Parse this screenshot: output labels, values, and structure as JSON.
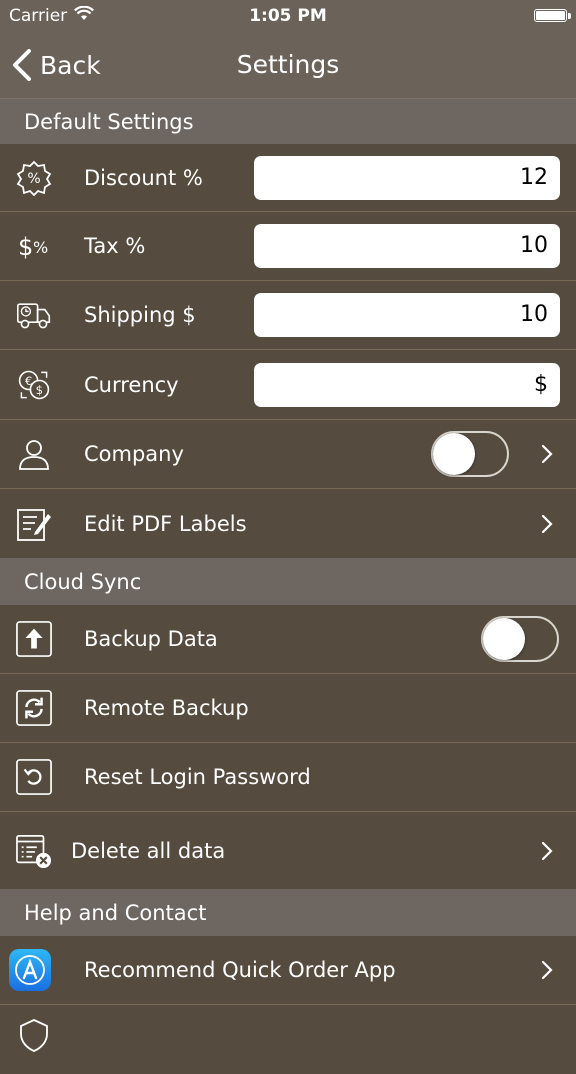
{
  "status_bar": {
    "carrier": "Carrier",
    "time": "1:05 PM"
  },
  "nav": {
    "back_label": "Back",
    "title": "Settings"
  },
  "sections": {
    "default_settings": {
      "header": "Default Settings",
      "discount": {
        "label": "Discount %",
        "value": "12",
        "icon": "discount-badge-icon"
      },
      "tax": {
        "label": "Tax %",
        "value": "10",
        "icon": "tax-percent-icon"
      },
      "shipping": {
        "label": "Shipping $",
        "value": "10",
        "icon": "delivery-truck-icon"
      },
      "currency": {
        "label": "Currency",
        "value": "$",
        "icon": "currency-exchange-icon"
      },
      "company": {
        "label": "Company",
        "toggle_on": false,
        "icon": "person-icon"
      },
      "edit_pdf": {
        "label": "Edit PDF Labels",
        "icon": "edit-document-icon"
      }
    },
    "cloud_sync": {
      "header": "Cloud Sync",
      "backup": {
        "label": "Backup Data",
        "toggle_on": false,
        "icon": "upload-icon"
      },
      "remote_backup": {
        "label": "Remote Backup",
        "icon": "sync-icon"
      },
      "reset_password": {
        "label": "Reset Login Password",
        "icon": "reset-icon"
      },
      "delete_data": {
        "label": "Delete all data",
        "icon": "delete-list-icon"
      }
    },
    "help": {
      "header": "Help and Contact",
      "recommend": {
        "label": "Recommend Quick Order App",
        "icon": "app-store-icon"
      }
    }
  }
}
